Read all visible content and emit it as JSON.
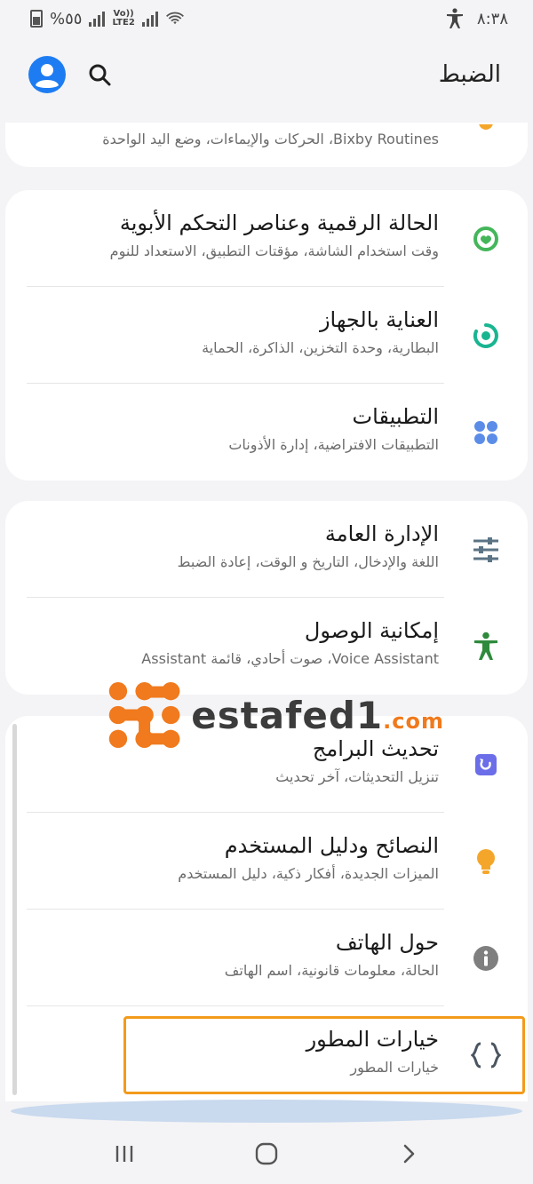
{
  "status_bar": {
    "battery": "%٥٥",
    "network_label_top": "Vo))",
    "network_label_bottom": "LTE2",
    "time": "٨:٣٨"
  },
  "header": {
    "title": "الضبط"
  },
  "icons": {
    "account": "account-icon",
    "search": "search-icon",
    "digital_wellbeing": "digital-wellbeing-icon",
    "device_care": "device-care-icon",
    "apps": "apps-icon",
    "general_management": "sliders-icon",
    "accessibility": "accessibility-icon",
    "software_update": "software-update-icon",
    "tips": "lightbulb-icon",
    "about_phone": "info-icon",
    "developer_options": "braces-icon"
  },
  "colors": {
    "accent_blue": "#1d7cf2",
    "wellbeing_green": "#43b65a",
    "device_care_teal": "#19b591",
    "apps_blue": "#5b8de8",
    "management_gray": "#5b7485",
    "accessibility_green": "#2f8a3c",
    "update_purple": "#6b6ee8",
    "tips_orange": "#f4a62a",
    "info_gray": "#7f7f7f",
    "highlight_orange": "#f39a1b"
  },
  "settings": {
    "advanced": {
      "subtitle": "Bixby Routines، الحركات والإيماءات، وضع اليد الواحدة"
    },
    "digital_wellbeing": {
      "title": "الحالة الرقمية وعناصر التحكم الأبوية",
      "subtitle": "وقت استخدام الشاشة، مؤقتات التطبيق، الاستعداد للنوم"
    },
    "device_care": {
      "title": "العناية بالجهاز",
      "subtitle": "البطارية، وحدة التخزين، الذاكرة، الحماية"
    },
    "apps": {
      "title": "التطبيقات",
      "subtitle": "التطبيقات الافتراضية، إدارة الأذونات"
    },
    "general_management": {
      "title": "الإدارة العامة",
      "subtitle": "اللغة والإدخال، التاريخ و الوقت، إعادة الضبط"
    },
    "accessibility": {
      "title": "إمكانية الوصول",
      "subtitle": "Voice Assistant، صوت أحادي، قائمة Assistant"
    },
    "software_update": {
      "title": "تحديث البرامج",
      "subtitle": "تنزيل التحديثات، آخر تحديث"
    },
    "tips": {
      "title": "النصائح ودليل المستخدم",
      "subtitle": "الميزات الجديدة، أفكار ذكية، دليل المستخدم"
    },
    "about_phone": {
      "title": "حول الهاتف",
      "subtitle": "الحالة، معلومات قانونية، اسم الهاتف"
    },
    "developer_options": {
      "title": "خيارات المطور",
      "subtitle": "خيارات المطور"
    }
  },
  "watermark": {
    "name": "estafed1",
    "domain": ".com"
  }
}
